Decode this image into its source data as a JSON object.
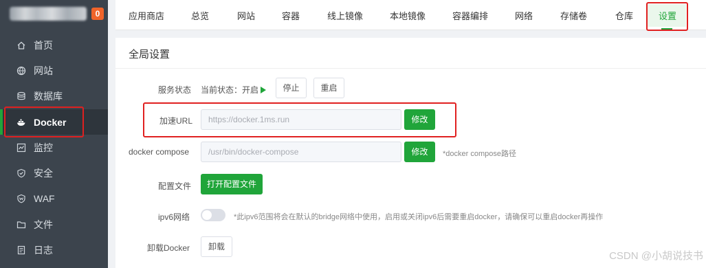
{
  "sidebar": {
    "badge": "0",
    "items": [
      {
        "label": "首页",
        "icon": "home-icon"
      },
      {
        "label": "网站",
        "icon": "globe-icon"
      },
      {
        "label": "数据库",
        "icon": "database-icon"
      },
      {
        "label": "Docker",
        "icon": "docker-icon"
      },
      {
        "label": "监控",
        "icon": "monitor-icon"
      },
      {
        "label": "安全",
        "icon": "shield-icon"
      },
      {
        "label": "WAF",
        "icon": "waf-shield-icon"
      },
      {
        "label": "文件",
        "icon": "folder-icon"
      },
      {
        "label": "日志",
        "icon": "log-icon"
      }
    ],
    "active": "Docker"
  },
  "tabs": [
    "应用商店",
    "总览",
    "网站",
    "容器",
    "线上镜像",
    "本地镜像",
    "容器编排",
    "网络",
    "存储卷",
    "仓库",
    "设置"
  ],
  "active_tab": "设置",
  "panel": {
    "title": "全局设置",
    "service": {
      "label": "服务状态",
      "status_text": "当前状态：开启",
      "stop_label": "停止",
      "restart_label": "重启"
    },
    "accel": {
      "label": "加速URL",
      "value": "https://docker.1ms.run",
      "button": "修改"
    },
    "compose": {
      "label": "docker compose",
      "value": "/usr/bin/docker-compose",
      "button": "修改",
      "hint": "*docker compose路径"
    },
    "config": {
      "label": "配置文件",
      "button": "打开配置文件"
    },
    "ipv6": {
      "label": "ipv6网络",
      "enabled": false,
      "hint": "*此ipv6范围将会在默认的bridge网络中使用，启用或关闭ipv6后需要重启docker，请确保可以重启docker再操作"
    },
    "uninstall": {
      "label": "卸载Docker",
      "button": "卸载"
    }
  },
  "watermark": "CSDN @小胡说技书",
  "colors": {
    "accent": "#20a53a",
    "sidebar_bg": "#3c444d",
    "highlight_box": "#e02020",
    "badge": "#f0642a"
  }
}
